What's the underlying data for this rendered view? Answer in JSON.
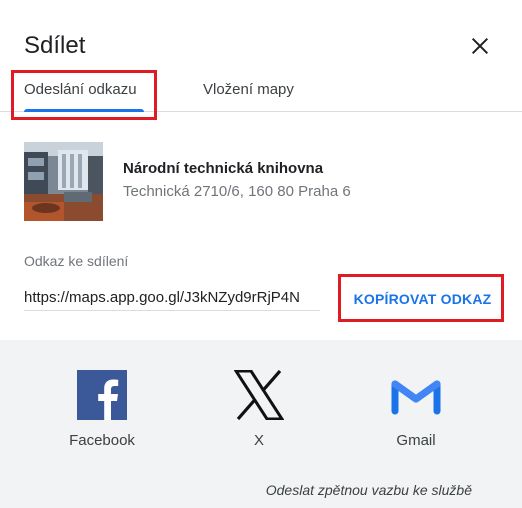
{
  "dialog": {
    "title": "Sdílet"
  },
  "tabs": [
    {
      "label": "Odeslání odkazu",
      "selected": true
    },
    {
      "label": "Vložení mapy",
      "selected": false
    }
  ],
  "place": {
    "name": "Národní technická knihovna",
    "address": "Technická 2710/6, 160 80 Praha 6"
  },
  "link": {
    "label": "Odkaz ke sdílení",
    "value": "https://maps.app.goo.gl/J3kNZyd9rRjP4N",
    "copy_label": "KOPÍROVAT ODKAZ"
  },
  "share_targets": [
    {
      "label": "Facebook",
      "icon": "facebook-icon"
    },
    {
      "label": "X",
      "icon": "x-icon"
    },
    {
      "label": "Gmail",
      "icon": "gmail-icon"
    }
  ],
  "feedback": "Odeslat zpětnou vazbu ke službě",
  "colors": {
    "accent": "#1a73e8",
    "annotation": "#e01b24",
    "facebook": "#3b5998",
    "share_bg": "#f1f3f4"
  }
}
